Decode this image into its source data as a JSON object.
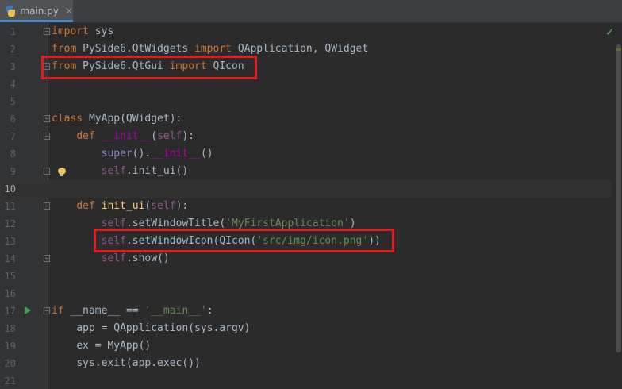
{
  "tab": {
    "filename": "main.py",
    "close_glyph": "✕",
    "icon": "python-file-icon"
  },
  "status": {
    "inspection_ok_glyph": "✓"
  },
  "lines": [
    {
      "n": "1"
    },
    {
      "n": "2"
    },
    {
      "n": "3"
    },
    {
      "n": "4"
    },
    {
      "n": "5"
    },
    {
      "n": "6"
    },
    {
      "n": "7"
    },
    {
      "n": "8"
    },
    {
      "n": "9"
    },
    {
      "n": "10"
    },
    {
      "n": "11"
    },
    {
      "n": "12"
    },
    {
      "n": "13"
    },
    {
      "n": "14"
    },
    {
      "n": "15"
    },
    {
      "n": "16"
    },
    {
      "n": "17"
    },
    {
      "n": "18"
    },
    {
      "n": "19"
    },
    {
      "n": "20"
    },
    {
      "n": "21"
    }
  ],
  "code": {
    "l1": {
      "kw": "import",
      "rest": " sys"
    },
    "l2": {
      "kw1": "from",
      "mid": " PySide6.QtWidgets ",
      "kw2": "import",
      "rest": " QApplication, QWidget"
    },
    "l3": {
      "kw1": "from",
      "mid": " PySide6.QtGui ",
      "kw2": "import",
      "rest": " QIcon"
    },
    "l6": {
      "kw": "class",
      "rest": " MyApp(QWidget):"
    },
    "l7": {
      "indent": "    ",
      "kw": "def",
      "sp": " ",
      "magic": "__init__",
      "open": "(",
      "self": "self",
      "close": "):"
    },
    "l8": {
      "indent": "        ",
      "builtin": "super",
      "mid": "().",
      "magic": "__init__",
      "rest": "()"
    },
    "l9": {
      "indent": "        ",
      "self": "self",
      "rest": ".init_ui()"
    },
    "l11": {
      "indent": "    ",
      "kw": "def",
      "sp": " ",
      "fn": "init_ui",
      "open": "(",
      "self": "self",
      "close": "):"
    },
    "l12": {
      "indent": "        ",
      "self": "self",
      "mid": ".setWindowTitle(",
      "str": "'MyFirstApplication'",
      "close": ")"
    },
    "l13": {
      "indent": "        ",
      "self": "self",
      "mid": ".setWindowIcon(QIcon(",
      "str": "'src/img/icon.png'",
      "close": "))"
    },
    "l14": {
      "indent": "        ",
      "self": "self",
      "rest": ".show()"
    },
    "l17": {
      "kw": "if",
      "mid": " __name__ == ",
      "str": "'__main__'",
      "close": ":"
    },
    "l18": {
      "indent": "    ",
      "text": "app = QApplication(sys.argv)"
    },
    "l19": {
      "indent": "    ",
      "text": "ex = MyApp()"
    },
    "l20": {
      "indent": "    ",
      "text": "sys.exit(app.exec())"
    }
  },
  "colors": {
    "highlight_box": "#e01e1e",
    "keyword": "#cc7832",
    "string": "#6a8759",
    "self": "#94558d",
    "magic": "#b200b2",
    "function": "#ffc66d"
  }
}
